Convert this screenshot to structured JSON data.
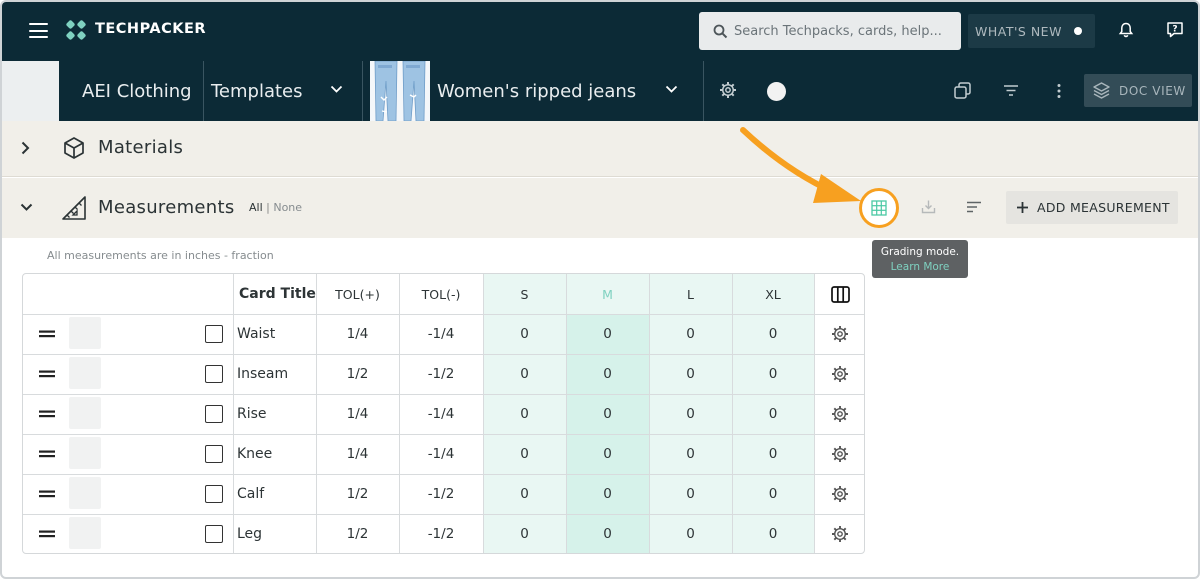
{
  "header": {
    "brand": "TECHPACKER",
    "search_placeholder": "Search Techpacks, cards, help...",
    "whats_new": "WHAT'S NEW"
  },
  "nav": {
    "company": "AEI Clothing",
    "folder": "Templates",
    "product": "Women's ripped jeans",
    "doc_view": "DOC VIEW"
  },
  "materials": {
    "title": "Materials"
  },
  "measurements": {
    "title": "Measurements",
    "filter_all": "All",
    "filter_none": "None",
    "add_label": "ADD MEASUREMENT",
    "unit_note": "All measurements are in inches - fraction",
    "tooltip_line1": "Grading mode.",
    "tooltip_line2": "Learn More"
  },
  "table": {
    "headers": [
      "Card Title",
      "TOL(+)",
      "TOL(-)",
      "S",
      "M",
      "L",
      "XL"
    ],
    "rows": [
      {
        "title": "Waist",
        "tol_plus": "1/4",
        "tol_minus": "-1/4",
        "s": "0",
        "m": "0",
        "l": "0",
        "xl": "0"
      },
      {
        "title": "Inseam",
        "tol_plus": "1/2",
        "tol_minus": "-1/2",
        "s": "0",
        "m": "0",
        "l": "0",
        "xl": "0"
      },
      {
        "title": "Rise",
        "tol_plus": "1/4",
        "tol_minus": "-1/4",
        "s": "0",
        "m": "0",
        "l": "0",
        "xl": "0"
      },
      {
        "title": "Knee",
        "tol_plus": "1/4",
        "tol_minus": "-1/4",
        "s": "0",
        "m": "0",
        "l": "0",
        "xl": "0"
      },
      {
        "title": "Calf",
        "tol_plus": "1/2",
        "tol_minus": "-1/2",
        "s": "0",
        "m": "0",
        "l": "0",
        "xl": "0"
      },
      {
        "title": "Leg",
        "tol_plus": "1/2",
        "tol_minus": "-1/2",
        "s": "0",
        "m": "0",
        "l": "0",
        "xl": "0"
      }
    ]
  },
  "colors": {
    "nav_bg": "#0c2a36",
    "accent_teal": "#7fd1c0",
    "highlight_orange": "#f7a020",
    "size_col_bg": "#e9f7f3",
    "selected_size_bg": "#d6f2ea"
  },
  "icons": [
    "menu-icon",
    "techpacker-logo-icon",
    "search-icon",
    "bell-icon",
    "help-icon",
    "chevron-down-icon",
    "gear-icon",
    "circle-icon",
    "copy-icon",
    "filter-icon",
    "more-vert-icon",
    "layers-icon",
    "chevron-right-icon",
    "cube-icon",
    "ruler-icon",
    "grid-icon",
    "download-icon",
    "sort-icon",
    "plus-icon",
    "drag-handle-icon",
    "columns-icon",
    "checkbox-icon"
  ]
}
